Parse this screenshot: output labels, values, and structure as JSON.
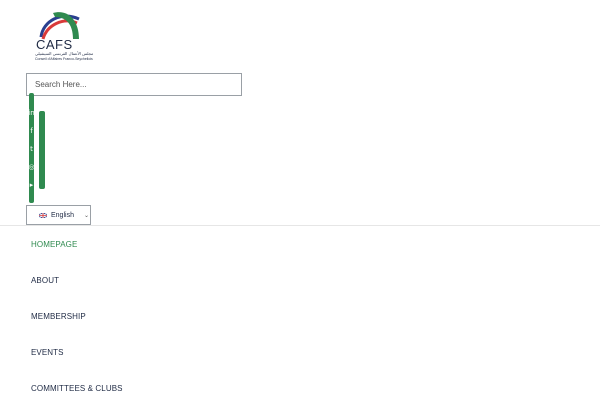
{
  "logo": {
    "abbr": "CAFS",
    "arabic": "مجلس الأعمال الفرنسي السيشيلي",
    "french": "Conseil d'Affaires Franco-Seychellois",
    "colors": {
      "green": "#2f8a4f",
      "red": "#d93a3a",
      "blue": "#2a3f8f"
    }
  },
  "search": {
    "placeholder": "Search Here..."
  },
  "social": {
    "color": "#2f8a4f",
    "icons": [
      "linkedin-icon",
      "facebook-icon",
      "twitter-icon",
      "instagram-icon",
      "youtube-icon"
    ],
    "glyphs": [
      "in",
      "f",
      "t",
      "◎",
      "▸"
    ]
  },
  "language": {
    "selected": "English",
    "flag": "uk-flag-icon"
  },
  "nav": {
    "active_color": "#2f8a4f",
    "items": [
      {
        "label": "HOMEPAGE",
        "active": true
      },
      {
        "label": "ABOUT",
        "active": false
      },
      {
        "label": "MEMBERSHIP",
        "active": false
      },
      {
        "label": "EVENTS",
        "active": false
      },
      {
        "label": "COMMITTEES & CLUBS",
        "active": false
      }
    ]
  }
}
